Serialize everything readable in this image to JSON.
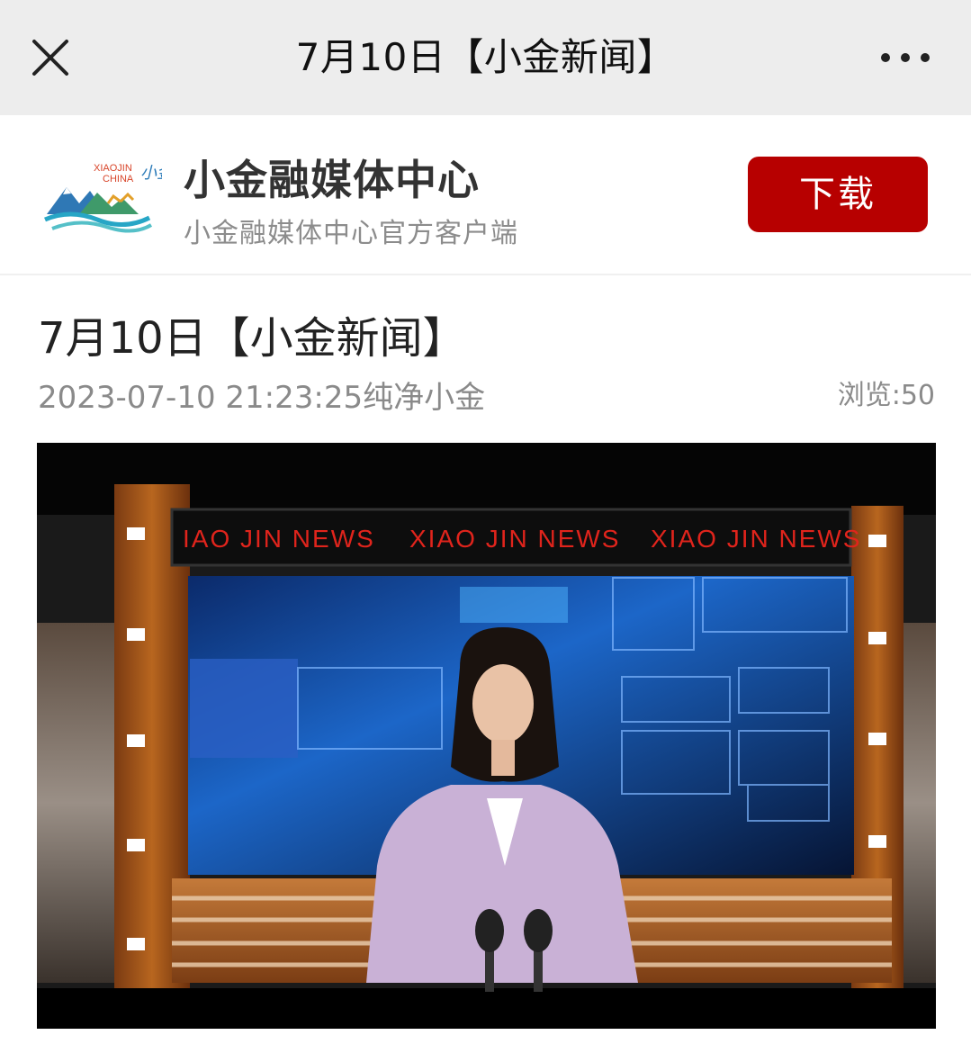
{
  "nav": {
    "title": "7月10日【小金新闻】",
    "close_icon": "close-icon",
    "more_icon": "more-icon"
  },
  "banner": {
    "app_name": "小金融媒体中心",
    "app_subtitle": "小金融媒体中心官方客户端",
    "download_label": "下载",
    "logo_text_en1": "XIAOJIN",
    "logo_text_en2": "CHINA",
    "logo_text_cn": "小金",
    "accent_color": "#b70000"
  },
  "article": {
    "title": "7月10日【小金新闻】",
    "meta": "2023-07-10 21:23:25纯净小金",
    "views_label": "浏览:",
    "views_count": "50"
  },
  "video": {
    "ticker": [
      "IAO  JIN  NEWS",
      "XIAO  JIN  NEWS",
      "XIAO  JIN  NEWS"
    ]
  }
}
